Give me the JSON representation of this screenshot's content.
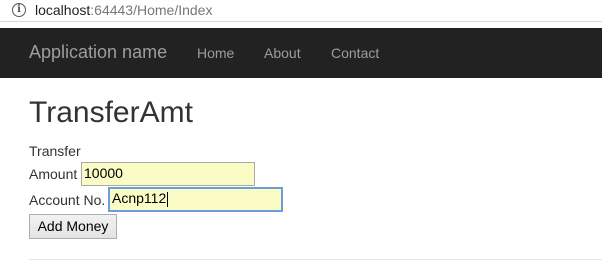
{
  "browser": {
    "icon": "info-icon",
    "url_host": "localhost",
    "url_rest": ":64443/Home/Index"
  },
  "navbar": {
    "brand": "Application name",
    "links": [
      "Home",
      "About",
      "Contact"
    ]
  },
  "page": {
    "title": "TransferAmt",
    "section_label": "Transfer",
    "amount_label": "Amount",
    "amount_value": "10000",
    "account_label": "Account No.",
    "account_value": "Acnp112",
    "button_label": "Add Money"
  },
  "colors": {
    "navbar_bg": "#222222",
    "input_fill": "#fbfbc6",
    "focus_border": "#6c9ddb"
  }
}
